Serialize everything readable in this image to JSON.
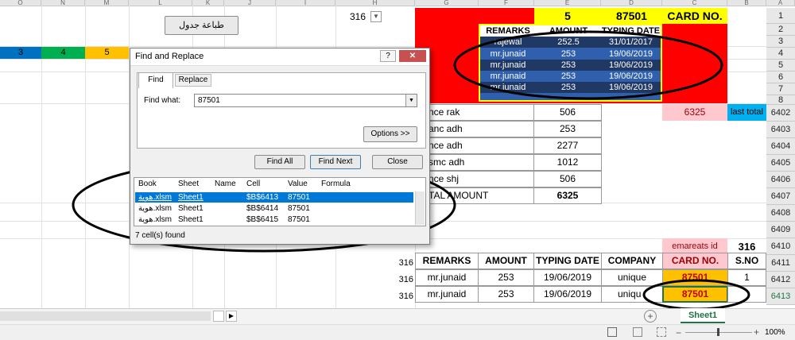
{
  "col_headers": [
    "O",
    "N",
    "M",
    "L",
    "K",
    "J",
    "I",
    "H",
    "G",
    "F",
    "E",
    "D",
    "C",
    "B",
    "A"
  ],
  "print_button": "طباعة جدول",
  "dropdown_value": "316",
  "colored_cells": [
    {
      "value": "3",
      "color": "#0070c0"
    },
    {
      "value": "4",
      "color": "#00b050"
    },
    {
      "value": "5",
      "color": "#ffc000"
    }
  ],
  "top_block": {
    "count": "5",
    "card_total": "87501",
    "card_no_label": "CARD NO.",
    "inner_headers": [
      "REMARKS",
      "AMOUNT",
      "TYPING DATE"
    ],
    "inner_rows": [
      [
        "rajewal",
        "252.5",
        "31/01/2017"
      ],
      [
        "mr.junaid",
        "253",
        "19/06/2019"
      ],
      [
        "mr.junaid",
        "253",
        "19/06/2019"
      ],
      [
        "mr.junaid",
        "253",
        "19/06/2019"
      ],
      [
        "mr.junaid",
        "253",
        "19/06/2019"
      ]
    ]
  },
  "row_numbers": [
    "1",
    "2",
    "3",
    "4",
    "5",
    "6",
    "7",
    "8",
    "6402",
    "6403",
    "6404",
    "6405",
    "6406",
    "6407",
    "6408",
    "6409",
    "6410",
    "6411",
    "6412",
    "6413"
  ],
  "summary": {
    "rows": [
      [
        "nce rak",
        "506"
      ],
      [
        "anc adh",
        "253"
      ],
      [
        "nce adh",
        "2277"
      ],
      [
        "smc adh",
        "1012"
      ],
      [
        "nce shj",
        "506"
      ]
    ],
    "total_label": "TAL AMOUNT",
    "total_value": "6325",
    "pink_value": "6325",
    "last_total_label": "last total"
  },
  "emareats_label": "emareats id",
  "emareats_value": "316",
  "bottom_table": {
    "headers": [
      "REMARKS",
      "AMOUNT",
      "TYPING DATE",
      "COMPANY",
      "CARD NO.",
      "S.NO"
    ],
    "rows": [
      {
        "side": "316",
        "cells": [
          "mr.junaid",
          "253",
          "19/06/2019",
          "unique",
          "87501",
          "1"
        ]
      },
      {
        "side": "316",
        "cells": [
          "mr.junaid",
          "253",
          "19/06/2019",
          "uniqu",
          "87501",
          ""
        ]
      }
    ],
    "header_side": "316"
  },
  "dialog": {
    "title": "Find and Replace",
    "help_label": "?",
    "close_label": "✕",
    "tabs": [
      "Find",
      "Replace"
    ],
    "find_label": "Find what:",
    "find_value": "87501",
    "options_button": "Options >>",
    "find_all_button": "Find All",
    "find_next_button": "Find Next",
    "close_button": "Close",
    "result_headers": [
      "Book",
      "Sheet",
      "Name",
      "Cell",
      "Value",
      "Formula"
    ],
    "results": [
      [
        "هوية.xlsm",
        "Sheet1",
        "",
        "$B$6413",
        "87501",
        ""
      ],
      [
        "هوية.xlsm",
        "Sheet1",
        "",
        "$B$6414",
        "87501",
        ""
      ],
      [
        "هوية.xlsm",
        "Sheet1",
        "",
        "$B$6415",
        "87501",
        ""
      ]
    ],
    "status": "7 cell(s) found"
  },
  "sheet_tab": "Sheet1",
  "zoom": "100%",
  "colors": {
    "red": "#ff0000",
    "yellow": "#ffff00",
    "blue_table": "#2f5fad",
    "pink": "#ffc7ce",
    "orange": "#ffc000",
    "teal": "#00b0f0"
  }
}
